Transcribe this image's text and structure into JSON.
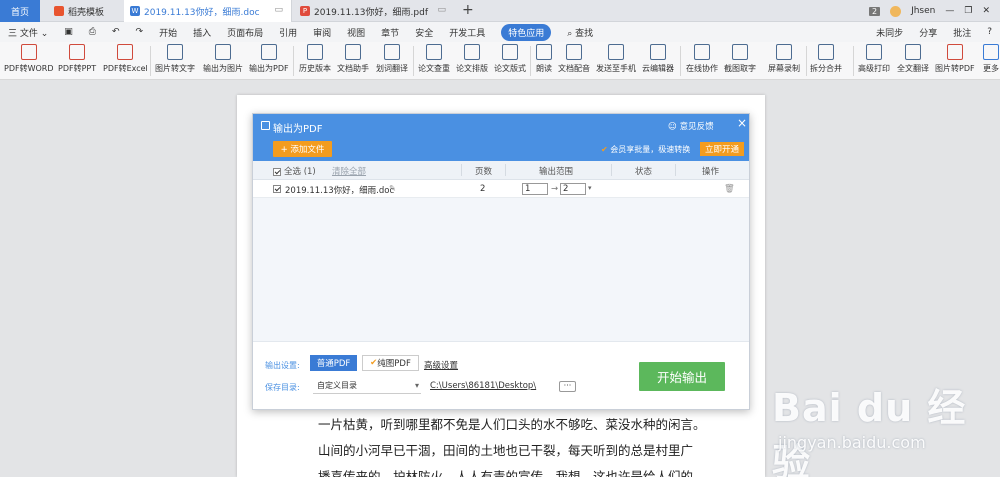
{
  "tabs": {
    "home": "首页",
    "template": "稻壳模板",
    "doc": "2019.11.13你好，细雨.doc",
    "pdf": "2019.11.13你好，细雨.pdf",
    "new": "+"
  },
  "topright": {
    "count": "2",
    "user": "Jhsen"
  },
  "menubar": {
    "file": "三 文件 ⌄",
    "items": [
      "开始",
      "插入",
      "页面布局",
      "引用",
      "审阅",
      "视图",
      "章节",
      "安全",
      "开发工具",
      "特色应用"
    ],
    "search": "查找",
    "sync": "未同步",
    "share": "分享",
    "comment": "批注"
  },
  "ribbon": [
    "PDF转WORD",
    "PDF转PPT",
    "PDF转Excel",
    "图片转文字",
    "输出为图片",
    "输出为PDF",
    "历史版本",
    "文档助手",
    "划词翻译",
    "论文查重",
    "论文排版",
    "论文版式",
    "朗读",
    "文档配音",
    "发送至手机",
    "云编辑器",
    "在线协作",
    "截图取字",
    "屏幕录制",
    "拆分合并",
    "高级打印",
    "全文翻译",
    "图片转PDF",
    "更多"
  ],
  "dialog": {
    "title": "输出为PDF",
    "feedback": "意见反馈",
    "close": "×",
    "add_file": "+ 添加文件",
    "vip_msg": "会员享批量，极速转换",
    "vip_btn": "立即开通",
    "header": {
      "select_all": "全选 (1)",
      "clear": "清除全部",
      "pages": "页数",
      "range": "输出范围",
      "status": "状态",
      "ops": "操作"
    },
    "file": {
      "name": "2019.11.13你好，细雨.doc",
      "pages": "2",
      "from": "1",
      "to": "2"
    },
    "settings_label": "输出设置:",
    "normal_pdf": "普通PDF",
    "pure_pdf": "纯图PDF",
    "advanced": "高级设置",
    "save_label": "保存目录:",
    "save_option": "自定义目录",
    "path": "C:\\Users\\86181\\Desktop\\",
    "more": "···",
    "start": "开始输出"
  },
  "doc_text": [
    "一片枯黄，听到哪里都不免是人们口头的水不够吃、菜没水种的闲言。",
    "山间的小河早已干涸，田间的土地也已干裂，每天听到的总是村里广",
    "播喜传来的，护林防火，人人有责的宣传。我想，这也许是给人们的"
  ],
  "watermark": {
    "main": "Bai du 经验",
    "url": "jingyan.baidu.com"
  },
  "colors": {
    "accent": "#3a7bd5",
    "dialog_header": "#4a90e2",
    "orange": "#f39c1f",
    "green": "#5cb85c"
  }
}
